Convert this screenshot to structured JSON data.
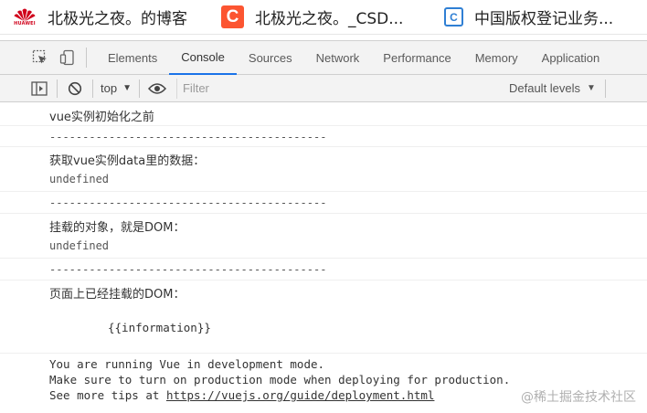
{
  "bookmarks": [
    {
      "label": "北极光之夜。的博客",
      "icon": "huawei-logo-icon"
    },
    {
      "label": "北极光之夜。_CSD...",
      "icon": "csdn-icon",
      "glyph": "C"
    },
    {
      "label": "中国版权登记业务...",
      "icon": "copyright-office-icon",
      "glyph": "C"
    }
  ],
  "devtools": {
    "tabs": [
      "Elements",
      "Console",
      "Sources",
      "Network",
      "Performance",
      "Memory",
      "Application"
    ],
    "active_tab": "Console"
  },
  "console_toolbar": {
    "context": "top",
    "filter_placeholder": "Filter",
    "levels": "Default levels"
  },
  "console": {
    "lines": [
      "vue实例初始化之前",
      "------------------------------------------",
      "获取vue实例data里的数据：",
      "undefined",
      "------------------------------------------",
      "挂载的对象，就是DOM：",
      "undefined",
      "------------------------------------------",
      "页面上已经挂载的DOM：",
      "{{information}}",
      "You are running Vue in development mode.",
      "Make sure to turn on production mode when deploying for production.",
      "See more tips at "
    ],
    "link": "https://vuejs.org/guide/deployment.html"
  },
  "watermark": "@稀土掘金技术社区",
  "colors": {
    "accent": "#1a73e8",
    "csdn": "#fc5531",
    "huawei": "#d0021b",
    "copyright": "#2f7fd4"
  }
}
